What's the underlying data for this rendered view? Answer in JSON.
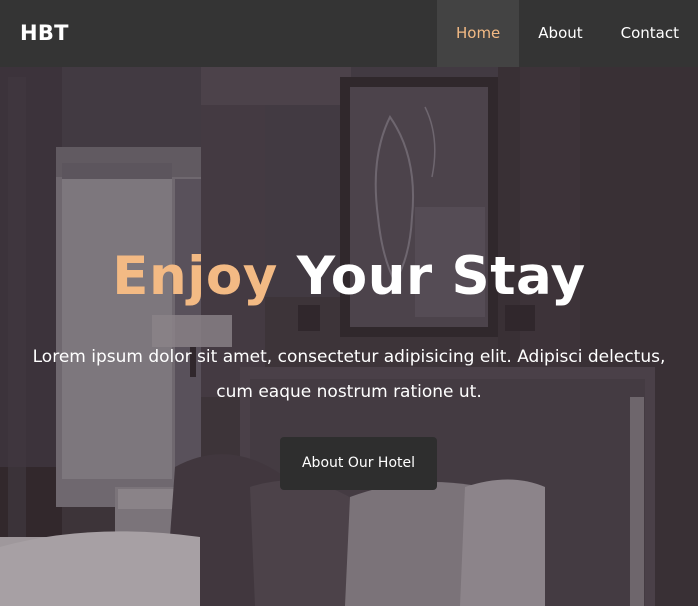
{
  "nav": {
    "brand": "HBT",
    "links": [
      {
        "label": "Home",
        "active": true
      },
      {
        "label": "About",
        "active": false
      },
      {
        "label": "Contact",
        "active": false
      }
    ]
  },
  "hero": {
    "title_accent": "Enjoy",
    "title_rest": " Your Stay",
    "text": "Lorem ipsum dolor sit amet, consectetur adipisicing elit. Adipisci delectus, cum eaque nostrum ratione ut.",
    "button_label": "About Our Hotel",
    "background_image": "hotel-room-photo"
  },
  "colors": {
    "accent": "#f3ba84",
    "navbar": "#343434",
    "navbar_active": "#434343",
    "button": "#2e2e2e",
    "text": "#ffffff"
  }
}
